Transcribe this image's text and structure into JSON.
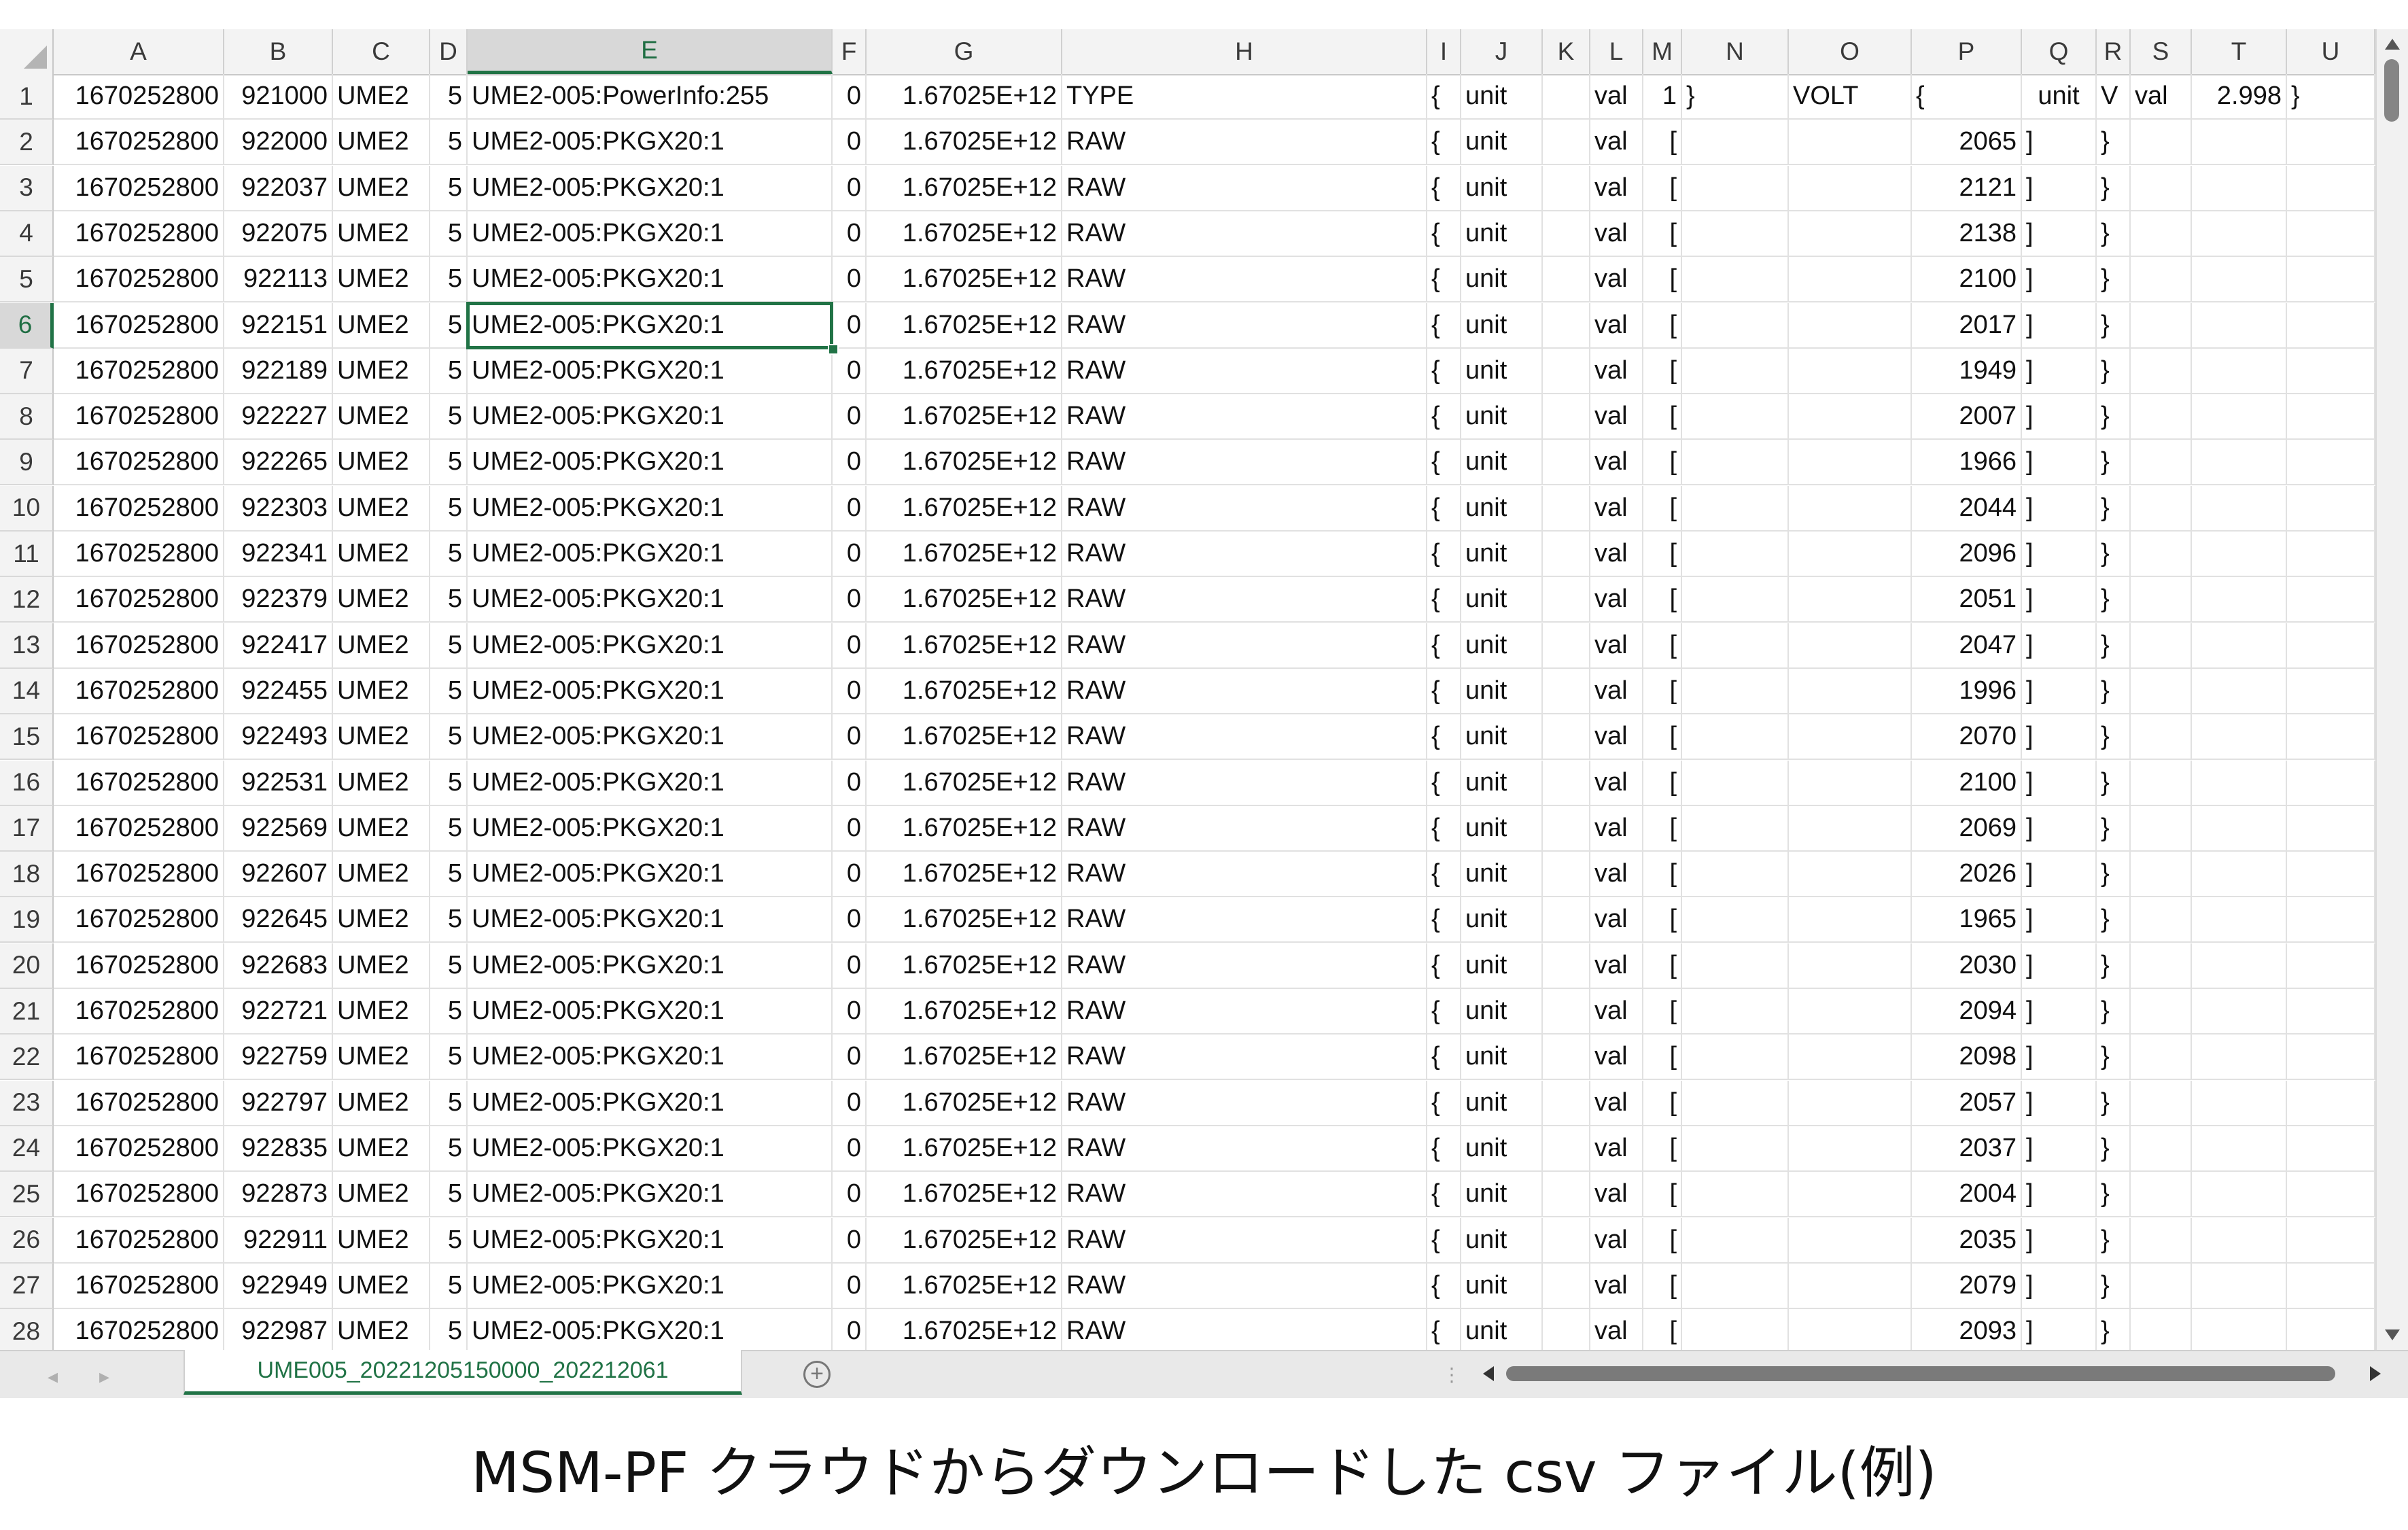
{
  "columns": [
    "A",
    "B",
    "C",
    "D",
    "E",
    "F",
    "G",
    "H",
    "I",
    "J",
    "K",
    "L",
    "M",
    "N",
    "O",
    "P",
    "Q",
    "R",
    "S",
    "T",
    "U"
  ],
  "active_column": "E",
  "active_row": "6",
  "rows": [
    {
      "num": "1",
      "A": "1670252800",
      "B": "921000",
      "C": "UME2",
      "D": "5",
      "E": "UME2-005:PowerInfo:255",
      "F": "0",
      "G": "1.67025E+12",
      "H": "TYPE",
      "I": "{",
      "J": "unit",
      "K": "",
      "L": "val",
      "M": "1",
      "N": "}",
      "O": "VOLT",
      "P": "{",
      "Q": "unit",
      "R": "V",
      "S": "val",
      "T": "2.998",
      "U": "}"
    },
    {
      "num": "2",
      "A": "1670252800",
      "B": "922000",
      "C": "UME2",
      "D": "5",
      "E": "UME2-005:PKGX20:1",
      "F": "0",
      "G": "1.67025E+12",
      "H": "RAW",
      "I": "{",
      "J": "unit",
      "K": "",
      "L": "val",
      "M": "[",
      "N": "",
      "O": "",
      "P": "2065",
      "Q": "]",
      "R": "}",
      "S": "",
      "T": "",
      "U": ""
    },
    {
      "num": "3",
      "A": "1670252800",
      "B": "922037",
      "C": "UME2",
      "D": "5",
      "E": "UME2-005:PKGX20:1",
      "F": "0",
      "G": "1.67025E+12",
      "H": "RAW",
      "I": "{",
      "J": "unit",
      "K": "",
      "L": "val",
      "M": "[",
      "N": "",
      "O": "",
      "P": "2121",
      "Q": "]",
      "R": "}",
      "S": "",
      "T": "",
      "U": ""
    },
    {
      "num": "4",
      "A": "1670252800",
      "B": "922075",
      "C": "UME2",
      "D": "5",
      "E": "UME2-005:PKGX20:1",
      "F": "0",
      "G": "1.67025E+12",
      "H": "RAW",
      "I": "{",
      "J": "unit",
      "K": "",
      "L": "val",
      "M": "[",
      "N": "",
      "O": "",
      "P": "2138",
      "Q": "]",
      "R": "}",
      "S": "",
      "T": "",
      "U": ""
    },
    {
      "num": "5",
      "A": "1670252800",
      "B": "922113",
      "C": "UME2",
      "D": "5",
      "E": "UME2-005:PKGX20:1",
      "F": "0",
      "G": "1.67025E+12",
      "H": "RAW",
      "I": "{",
      "J": "unit",
      "K": "",
      "L": "val",
      "M": "[",
      "N": "",
      "O": "",
      "P": "2100",
      "Q": "]",
      "R": "}",
      "S": "",
      "T": "",
      "U": ""
    },
    {
      "num": "6",
      "A": "1670252800",
      "B": "922151",
      "C": "UME2",
      "D": "5",
      "E": "UME2-005:PKGX20:1",
      "F": "0",
      "G": "1.67025E+12",
      "H": "RAW",
      "I": "{",
      "J": "unit",
      "K": "",
      "L": "val",
      "M": "[",
      "N": "",
      "O": "",
      "P": "2017",
      "Q": "]",
      "R": "}",
      "S": "",
      "T": "",
      "U": ""
    },
    {
      "num": "7",
      "A": "1670252800",
      "B": "922189",
      "C": "UME2",
      "D": "5",
      "E": "UME2-005:PKGX20:1",
      "F": "0",
      "G": "1.67025E+12",
      "H": "RAW",
      "I": "{",
      "J": "unit",
      "K": "",
      "L": "val",
      "M": "[",
      "N": "",
      "O": "",
      "P": "1949",
      "Q": "]",
      "R": "}",
      "S": "",
      "T": "",
      "U": ""
    },
    {
      "num": "8",
      "A": "1670252800",
      "B": "922227",
      "C": "UME2",
      "D": "5",
      "E": "UME2-005:PKGX20:1",
      "F": "0",
      "G": "1.67025E+12",
      "H": "RAW",
      "I": "{",
      "J": "unit",
      "K": "",
      "L": "val",
      "M": "[",
      "N": "",
      "O": "",
      "P": "2007",
      "Q": "]",
      "R": "}",
      "S": "",
      "T": "",
      "U": ""
    },
    {
      "num": "9",
      "A": "1670252800",
      "B": "922265",
      "C": "UME2",
      "D": "5",
      "E": "UME2-005:PKGX20:1",
      "F": "0",
      "G": "1.67025E+12",
      "H": "RAW",
      "I": "{",
      "J": "unit",
      "K": "",
      "L": "val",
      "M": "[",
      "N": "",
      "O": "",
      "P": "1966",
      "Q": "]",
      "R": "}",
      "S": "",
      "T": "",
      "U": ""
    },
    {
      "num": "10",
      "A": "1670252800",
      "B": "922303",
      "C": "UME2",
      "D": "5",
      "E": "UME2-005:PKGX20:1",
      "F": "0",
      "G": "1.67025E+12",
      "H": "RAW",
      "I": "{",
      "J": "unit",
      "K": "",
      "L": "val",
      "M": "[",
      "N": "",
      "O": "",
      "P": "2044",
      "Q": "]",
      "R": "}",
      "S": "",
      "T": "",
      "U": ""
    },
    {
      "num": "11",
      "A": "1670252800",
      "B": "922341",
      "C": "UME2",
      "D": "5",
      "E": "UME2-005:PKGX20:1",
      "F": "0",
      "G": "1.67025E+12",
      "H": "RAW",
      "I": "{",
      "J": "unit",
      "K": "",
      "L": "val",
      "M": "[",
      "N": "",
      "O": "",
      "P": "2096",
      "Q": "]",
      "R": "}",
      "S": "",
      "T": "",
      "U": ""
    },
    {
      "num": "12",
      "A": "1670252800",
      "B": "922379",
      "C": "UME2",
      "D": "5",
      "E": "UME2-005:PKGX20:1",
      "F": "0",
      "G": "1.67025E+12",
      "H": "RAW",
      "I": "{",
      "J": "unit",
      "K": "",
      "L": "val",
      "M": "[",
      "N": "",
      "O": "",
      "P": "2051",
      "Q": "]",
      "R": "}",
      "S": "",
      "T": "",
      "U": ""
    },
    {
      "num": "13",
      "A": "1670252800",
      "B": "922417",
      "C": "UME2",
      "D": "5",
      "E": "UME2-005:PKGX20:1",
      "F": "0",
      "G": "1.67025E+12",
      "H": "RAW",
      "I": "{",
      "J": "unit",
      "K": "",
      "L": "val",
      "M": "[",
      "N": "",
      "O": "",
      "P": "2047",
      "Q": "]",
      "R": "}",
      "S": "",
      "T": "",
      "U": ""
    },
    {
      "num": "14",
      "A": "1670252800",
      "B": "922455",
      "C": "UME2",
      "D": "5",
      "E": "UME2-005:PKGX20:1",
      "F": "0",
      "G": "1.67025E+12",
      "H": "RAW",
      "I": "{",
      "J": "unit",
      "K": "",
      "L": "val",
      "M": "[",
      "N": "",
      "O": "",
      "P": "1996",
      "Q": "]",
      "R": "}",
      "S": "",
      "T": "",
      "U": ""
    },
    {
      "num": "15",
      "A": "1670252800",
      "B": "922493",
      "C": "UME2",
      "D": "5",
      "E": "UME2-005:PKGX20:1",
      "F": "0",
      "G": "1.67025E+12",
      "H": "RAW",
      "I": "{",
      "J": "unit",
      "K": "",
      "L": "val",
      "M": "[",
      "N": "",
      "O": "",
      "P": "2070",
      "Q": "]",
      "R": "}",
      "S": "",
      "T": "",
      "U": ""
    },
    {
      "num": "16",
      "A": "1670252800",
      "B": "922531",
      "C": "UME2",
      "D": "5",
      "E": "UME2-005:PKGX20:1",
      "F": "0",
      "G": "1.67025E+12",
      "H": "RAW",
      "I": "{",
      "J": "unit",
      "K": "",
      "L": "val",
      "M": "[",
      "N": "",
      "O": "",
      "P": "2100",
      "Q": "]",
      "R": "}",
      "S": "",
      "T": "",
      "U": ""
    },
    {
      "num": "17",
      "A": "1670252800",
      "B": "922569",
      "C": "UME2",
      "D": "5",
      "E": "UME2-005:PKGX20:1",
      "F": "0",
      "G": "1.67025E+12",
      "H": "RAW",
      "I": "{",
      "J": "unit",
      "K": "",
      "L": "val",
      "M": "[",
      "N": "",
      "O": "",
      "P": "2069",
      "Q": "]",
      "R": "}",
      "S": "",
      "T": "",
      "U": ""
    },
    {
      "num": "18",
      "A": "1670252800",
      "B": "922607",
      "C": "UME2",
      "D": "5",
      "E": "UME2-005:PKGX20:1",
      "F": "0",
      "G": "1.67025E+12",
      "H": "RAW",
      "I": "{",
      "J": "unit",
      "K": "",
      "L": "val",
      "M": "[",
      "N": "",
      "O": "",
      "P": "2026",
      "Q": "]",
      "R": "}",
      "S": "",
      "T": "",
      "U": ""
    },
    {
      "num": "19",
      "A": "1670252800",
      "B": "922645",
      "C": "UME2",
      "D": "5",
      "E": "UME2-005:PKGX20:1",
      "F": "0",
      "G": "1.67025E+12",
      "H": "RAW",
      "I": "{",
      "J": "unit",
      "K": "",
      "L": "val",
      "M": "[",
      "N": "",
      "O": "",
      "P": "1965",
      "Q": "]",
      "R": "}",
      "S": "",
      "T": "",
      "U": ""
    },
    {
      "num": "20",
      "A": "1670252800",
      "B": "922683",
      "C": "UME2",
      "D": "5",
      "E": "UME2-005:PKGX20:1",
      "F": "0",
      "G": "1.67025E+12",
      "H": "RAW",
      "I": "{",
      "J": "unit",
      "K": "",
      "L": "val",
      "M": "[",
      "N": "",
      "O": "",
      "P": "2030",
      "Q": "]",
      "R": "}",
      "S": "",
      "T": "",
      "U": ""
    },
    {
      "num": "21",
      "A": "1670252800",
      "B": "922721",
      "C": "UME2",
      "D": "5",
      "E": "UME2-005:PKGX20:1",
      "F": "0",
      "G": "1.67025E+12",
      "H": "RAW",
      "I": "{",
      "J": "unit",
      "K": "",
      "L": "val",
      "M": "[",
      "N": "",
      "O": "",
      "P": "2094",
      "Q": "]",
      "R": "}",
      "S": "",
      "T": "",
      "U": ""
    },
    {
      "num": "22",
      "A": "1670252800",
      "B": "922759",
      "C": "UME2",
      "D": "5",
      "E": "UME2-005:PKGX20:1",
      "F": "0",
      "G": "1.67025E+12",
      "H": "RAW",
      "I": "{",
      "J": "unit",
      "K": "",
      "L": "val",
      "M": "[",
      "N": "",
      "O": "",
      "P": "2098",
      "Q": "]",
      "R": "}",
      "S": "",
      "T": "",
      "U": ""
    },
    {
      "num": "23",
      "A": "1670252800",
      "B": "922797",
      "C": "UME2",
      "D": "5",
      "E": "UME2-005:PKGX20:1",
      "F": "0",
      "G": "1.67025E+12",
      "H": "RAW",
      "I": "{",
      "J": "unit",
      "K": "",
      "L": "val",
      "M": "[",
      "N": "",
      "O": "",
      "P": "2057",
      "Q": "]",
      "R": "}",
      "S": "",
      "T": "",
      "U": ""
    },
    {
      "num": "24",
      "A": "1670252800",
      "B": "922835",
      "C": "UME2",
      "D": "5",
      "E": "UME2-005:PKGX20:1",
      "F": "0",
      "G": "1.67025E+12",
      "H": "RAW",
      "I": "{",
      "J": "unit",
      "K": "",
      "L": "val",
      "M": "[",
      "N": "",
      "O": "",
      "P": "2037",
      "Q": "]",
      "R": "}",
      "S": "",
      "T": "",
      "U": ""
    },
    {
      "num": "25",
      "A": "1670252800",
      "B": "922873",
      "C": "UME2",
      "D": "5",
      "E": "UME2-005:PKGX20:1",
      "F": "0",
      "G": "1.67025E+12",
      "H": "RAW",
      "I": "{",
      "J": "unit",
      "K": "",
      "L": "val",
      "M": "[",
      "N": "",
      "O": "",
      "P": "2004",
      "Q": "]",
      "R": "}",
      "S": "",
      "T": "",
      "U": ""
    },
    {
      "num": "26",
      "A": "1670252800",
      "B": "922911",
      "C": "UME2",
      "D": "5",
      "E": "UME2-005:PKGX20:1",
      "F": "0",
      "G": "1.67025E+12",
      "H": "RAW",
      "I": "{",
      "J": "unit",
      "K": "",
      "L": "val",
      "M": "[",
      "N": "",
      "O": "",
      "P": "2035",
      "Q": "]",
      "R": "}",
      "S": "",
      "T": "",
      "U": ""
    },
    {
      "num": "27",
      "A": "1670252800",
      "B": "922949",
      "C": "UME2",
      "D": "5",
      "E": "UME2-005:PKGX20:1",
      "F": "0",
      "G": "1.67025E+12",
      "H": "RAW",
      "I": "{",
      "J": "unit",
      "K": "",
      "L": "val",
      "M": "[",
      "N": "",
      "O": "",
      "P": "2079",
      "Q": "]",
      "R": "}",
      "S": "",
      "T": "",
      "U": ""
    },
    {
      "num": "28",
      "A": "1670252800",
      "B": "922987",
      "C": "UME2",
      "D": "5",
      "E": "UME2-005:PKGX20:1",
      "F": "0",
      "G": "1.67025E+12",
      "H": "RAW",
      "I": "{",
      "J": "unit",
      "K": "",
      "L": "val",
      "M": "[",
      "N": "",
      "O": "",
      "P": "2093",
      "Q": "]",
      "R": "}",
      "S": "",
      "T": "",
      "U": ""
    }
  ],
  "sheet_tab": "UME005_20221205150000_202212061",
  "add_sheet_label": "+",
  "caption": "MSM-PF クラウドからダウンロードした csv ファイル(例)",
  "colors": {
    "accent": "#217346",
    "header_bg": "#f3f3f3",
    "gridline": "#e1e1e1"
  }
}
